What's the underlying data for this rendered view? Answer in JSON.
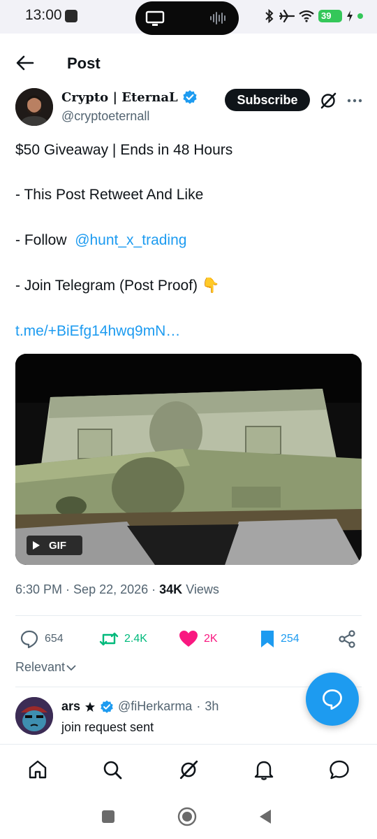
{
  "status_bar": {
    "time": "13:00",
    "battery": "39"
  },
  "header": {
    "title": "Post"
  },
  "author": {
    "name": "Crypto | EternaL",
    "handle": "@cryptoeternall",
    "subscribe_label": "Subscribe"
  },
  "post": {
    "line1": "$50 Giveaway | Ends in 48 Hours",
    "line2": "- This Post Retweet And Like",
    "line3_prefix": "- Follow",
    "line3_mention": "@hunt_x_trading",
    "line4": "- Join Telegram (Post Proof)",
    "line4_emoji": "👇",
    "link": "t.me/+BiEfg14hwq9mN…"
  },
  "media": {
    "badge": "GIF"
  },
  "meta": {
    "time": "6:30 PM",
    "date": "Sep 22, 2026",
    "views_count": "34K",
    "views_label": "Views"
  },
  "actions": {
    "replies": "654",
    "reposts": "2.4K",
    "likes": "2K",
    "bookmarks": "254"
  },
  "sort": {
    "label": "Relevant"
  },
  "reply": {
    "name": "ars",
    "handle": "@fiHerkarma",
    "time": "3h",
    "text": "join request sent"
  },
  "colors": {
    "accent": "#1d9bf0",
    "repost": "#00ba7c",
    "like": "#f91880"
  }
}
